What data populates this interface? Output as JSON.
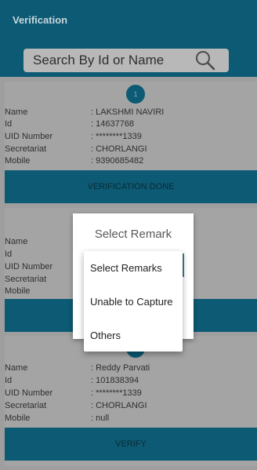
{
  "header": {
    "title": "Verification",
    "search_placeholder": "Search By Id or Name"
  },
  "labels": {
    "name": "Name",
    "id": "Id",
    "uid": "UID Number",
    "secretariat": "Secretariat",
    "mobile": "Mobile"
  },
  "records": [
    {
      "serial": "1",
      "name": ": LAKSHMI NAVIRI",
      "id": ": 14637768",
      "uid": ": ********1339",
      "secretariat": ": CHORLANGI",
      "mobile": ": 9390685482",
      "action": "VERIFICATION DONE"
    },
    {
      "name": ": Reddy Parvati",
      "id": ": 101838394",
      "uid": ": ********1339",
      "secretariat": ": CHORLANGI",
      "mobile": ": null",
      "action": "VERIFY"
    }
  ],
  "dialog": {
    "title": "Select Remark",
    "options": [
      "Select Remarks",
      "Unable to Capture",
      "Others"
    ]
  },
  "colors": {
    "primary": "#0c5a74",
    "overlay_bg": "#9e9e9e",
    "dialog_bg": "#ffffff"
  }
}
